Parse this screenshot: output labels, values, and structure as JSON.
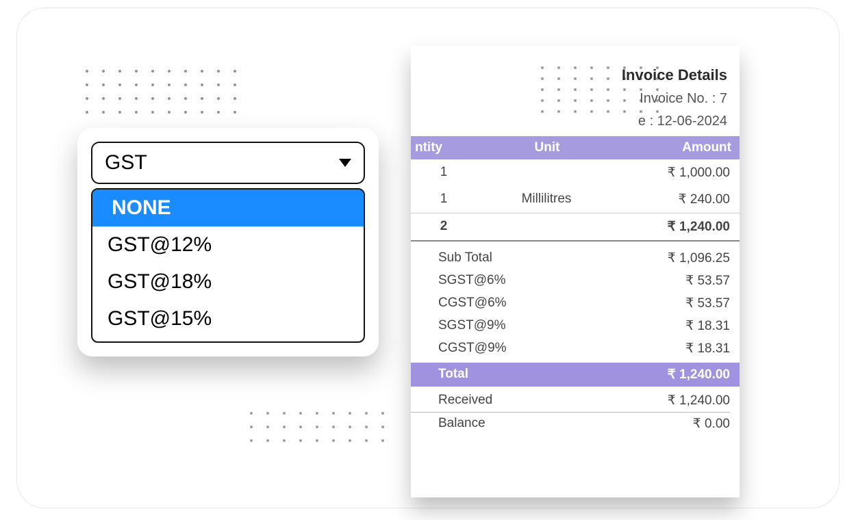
{
  "dropdown": {
    "label": "GST",
    "options": [
      "NONE",
      "GST@12%",
      "GST@18%",
      "GST@15%"
    ],
    "selected_index": 0
  },
  "invoice": {
    "title": "Invoice Details",
    "number_label": "Invoice No. : 7",
    "date_label": "e : 12-06-2024",
    "columns": {
      "qty": "ntity",
      "unit": "Unit",
      "amount": "Amount"
    },
    "rows": [
      {
        "qty": "1",
        "unit": "",
        "amount": "₹ 1,000.00"
      },
      {
        "qty": "1",
        "unit": "Millilitres",
        "amount": "₹ 240.00"
      }
    ],
    "total_row": {
      "qty": "2",
      "unit": "",
      "amount": "₹ 1,240.00"
    },
    "summary": [
      {
        "label": "Sub Total",
        "value": "₹ 1,096.25"
      },
      {
        "label": "SGST@6%",
        "value": "₹ 53.57"
      },
      {
        "label": "CGST@6%",
        "value": "₹ 53.57"
      },
      {
        "label": "SGST@9%",
        "value": "₹ 18.31"
      },
      {
        "label": "CGST@9%",
        "value": "₹ 18.31"
      }
    ],
    "grand_total": {
      "label": "Total",
      "value": "₹ 1,240.00"
    },
    "received": {
      "label": "Received",
      "value": "₹ 1,240.00"
    },
    "balance": {
      "label": "Balance",
      "value": "₹ 0.00"
    }
  }
}
